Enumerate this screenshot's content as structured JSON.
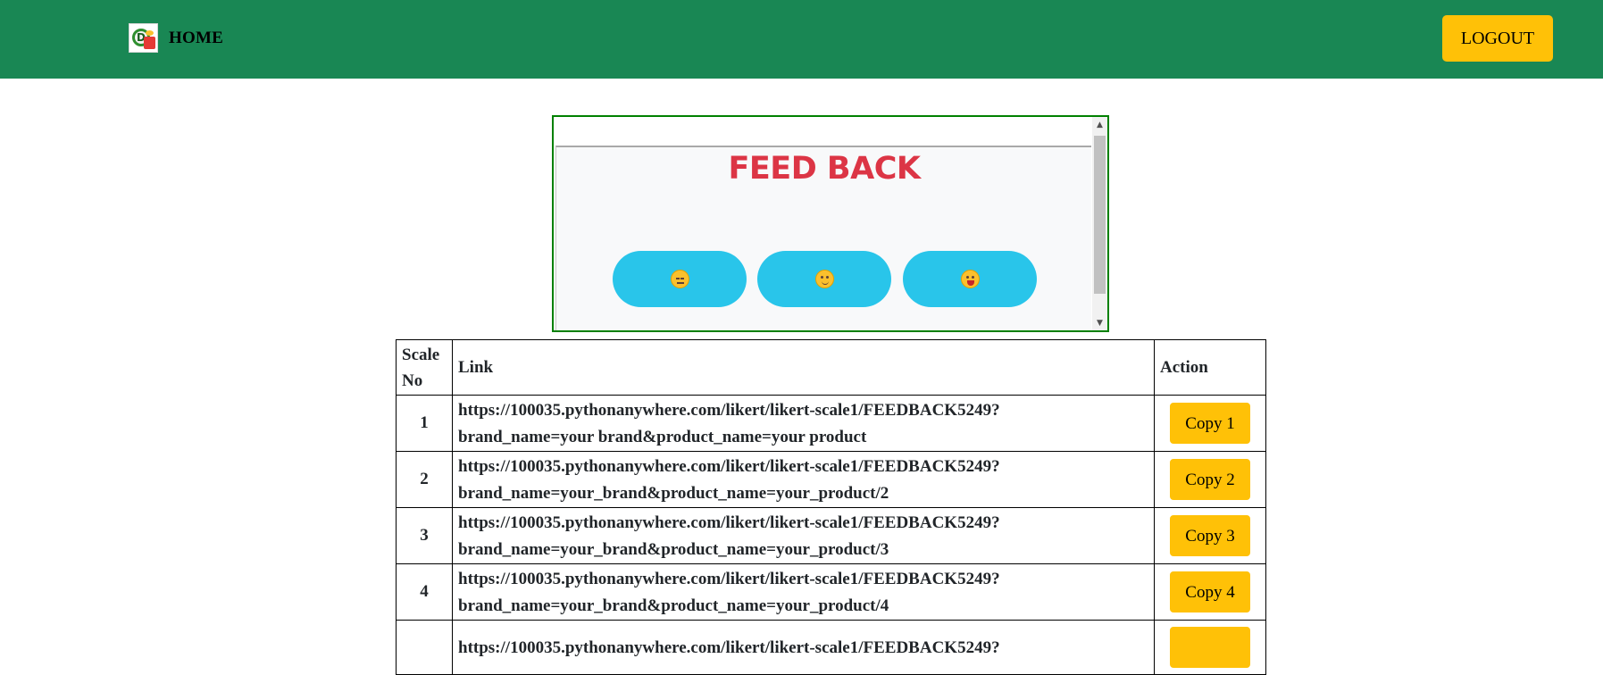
{
  "header": {
    "brand_text": "HOME",
    "logo_letter": "D",
    "logout_label": "LOGOUT",
    "bg_color": "#198754",
    "button_color": "#ffc107"
  },
  "feedback_widget": {
    "title": "FEED BACK",
    "buttons": [
      {
        "icon": "pensive-face-icon"
      },
      {
        "icon": "smiling-face-icon"
      },
      {
        "icon": "laughing-face-icon"
      }
    ],
    "button_color": "#29c5ea",
    "title_color": "#dc3545",
    "scroll_up": "▲",
    "scroll_down": "▼"
  },
  "table": {
    "headers": {
      "scale_no_line1": "Scale",
      "scale_no_line2": "No",
      "link": "Link",
      "action": "Action"
    },
    "rows": [
      {
        "no": "1",
        "link": "https://100035.pythonanywhere.com/likert/likert-scale1/FEEDBACK5249?brand_name=your brand&product_name=your product",
        "link_line1": "https://100035.pythonanywhere.com/likert/likert-scale1/FEEDBACK5249?",
        "link_line2": "brand_name=your brand&product_name=your product",
        "action": "Copy 1"
      },
      {
        "no": "2",
        "link": "https://100035.pythonanywhere.com/likert/likert-scale1/FEEDBACK5249?brand_name=your_brand&product_name=your_product/2",
        "link_line1": "https://100035.pythonanywhere.com/likert/likert-scale1/FEEDBACK5249?",
        "link_line2": "brand_name=your_brand&product_name=your_product/2",
        "action": "Copy 2"
      },
      {
        "no": "3",
        "link": "https://100035.pythonanywhere.com/likert/likert-scale1/FEEDBACK5249?brand_name=your_brand&product_name=your_product/3",
        "link_line1": "https://100035.pythonanywhere.com/likert/likert-scale1/FEEDBACK5249?",
        "link_line2": "brand_name=your_brand&product_name=your_product/3",
        "action": "Copy 3"
      },
      {
        "no": "4",
        "link": "https://100035.pythonanywhere.com/likert/likert-scale1/FEEDBACK5249?brand_name=your_brand&product_name=your_product/4",
        "link_line1": "https://100035.pythonanywhere.com/likert/likert-scale1/FEEDBACK5249?",
        "link_line2": "brand_name=your_brand&product_name=your_product/4",
        "action": "Copy 4"
      },
      {
        "no": "",
        "link": "https://100035.pythonanywhere.com/likert/likert-scale1/FEEDBACK5249?",
        "link_line1": "https://100035.pythonanywhere.com/likert/likert-scale1/FEEDBACK5249?",
        "link_line2": "",
        "action": ""
      }
    ]
  }
}
